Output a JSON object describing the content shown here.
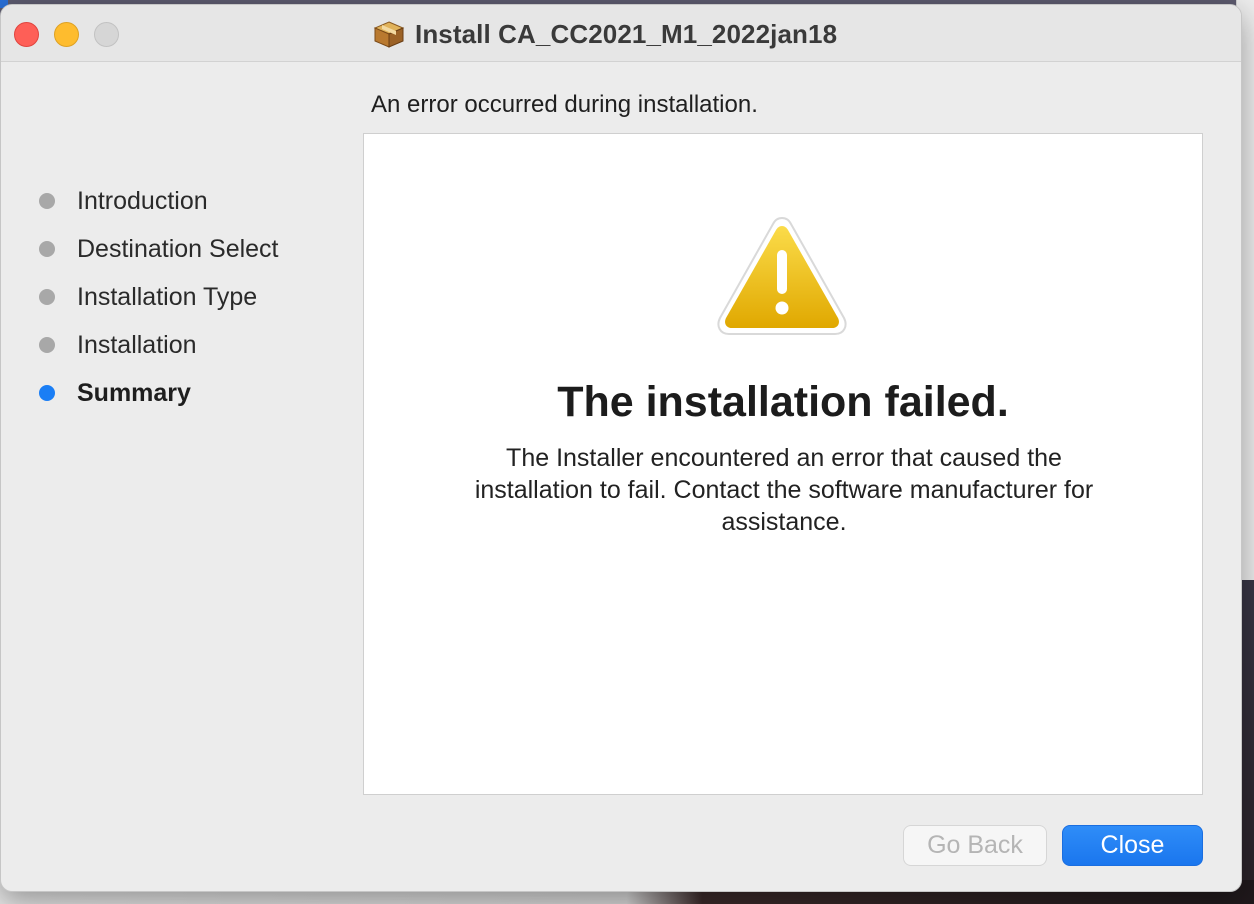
{
  "window": {
    "title": "Install CA_CC2021_M1_2022jan18",
    "title_icon": "package-icon"
  },
  "header": {
    "message": "An error occurred during installation."
  },
  "sidebar": {
    "items": [
      {
        "label": "Introduction",
        "active": false
      },
      {
        "label": "Destination Select",
        "active": false
      },
      {
        "label": "Installation Type",
        "active": false
      },
      {
        "label": "Installation",
        "active": false
      },
      {
        "label": "Summary",
        "active": true
      }
    ]
  },
  "content": {
    "icon": "warning-icon",
    "title": "The installation failed.",
    "message": "The Installer encountered an error that caused the installation to fail. Contact the software manufacturer for assistance."
  },
  "buttons": {
    "go_back": "Go Back",
    "close": "Close"
  },
  "colors": {
    "accent": "#1a7ef5",
    "warning": "#f2c200"
  }
}
